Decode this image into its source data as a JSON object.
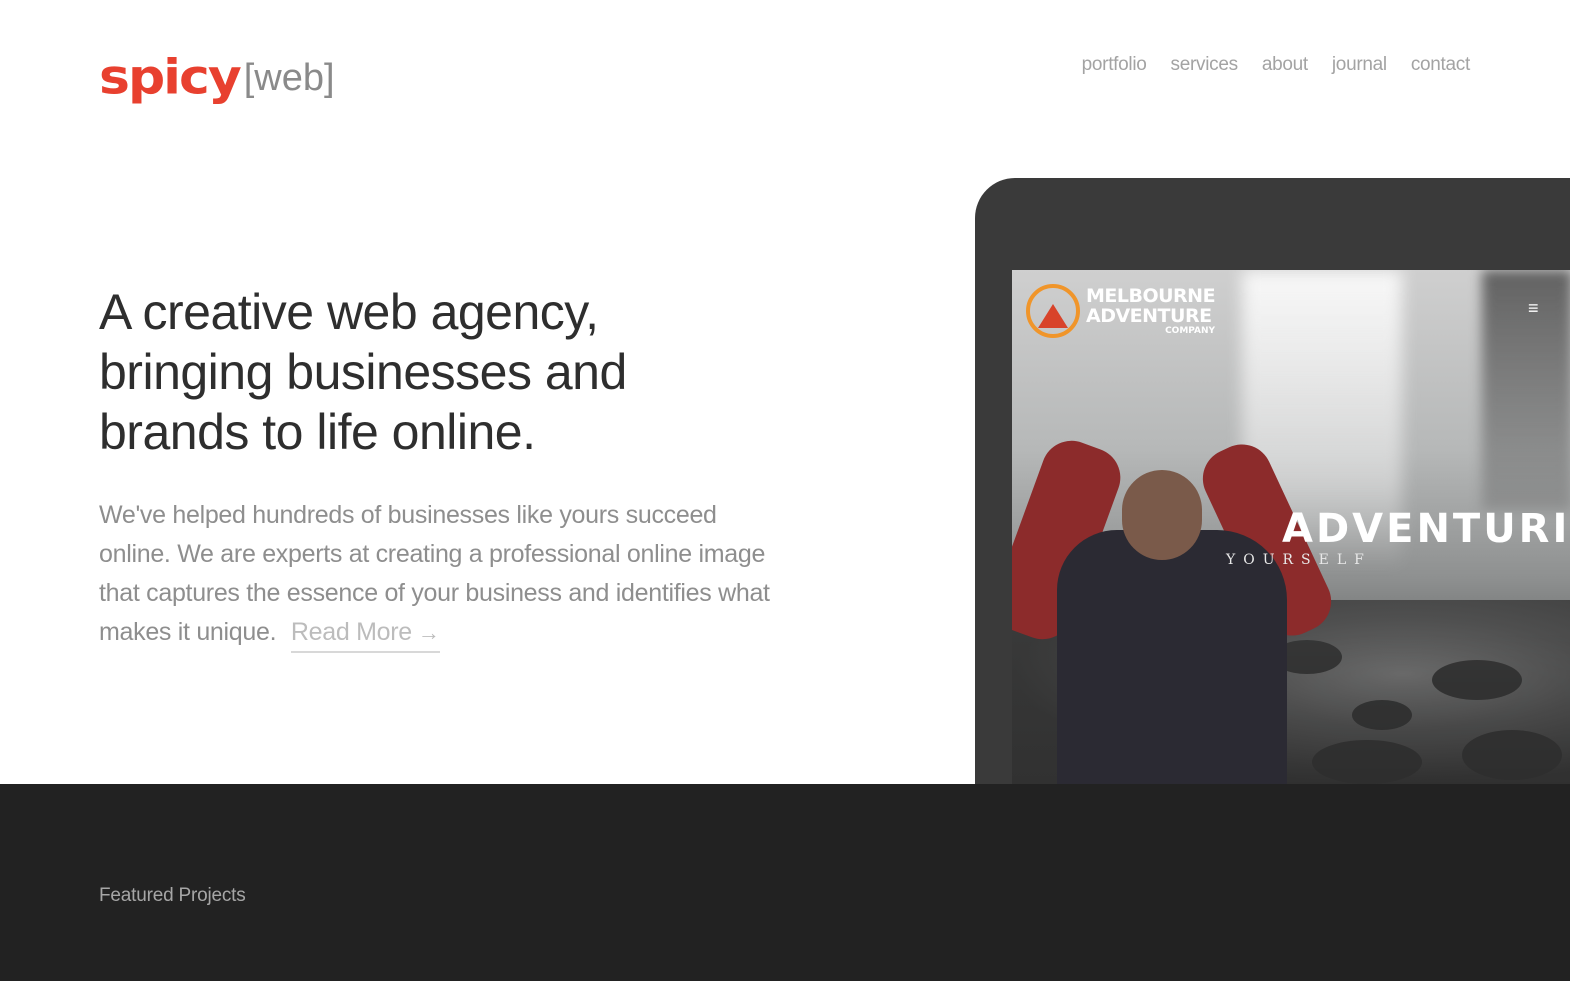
{
  "header": {
    "logo_main": "spicy",
    "logo_suffix": "[web]",
    "nav": [
      "portfolio",
      "services",
      "about",
      "journal",
      "contact"
    ]
  },
  "hero": {
    "title": "A creative web agency, bringing businesses and brands to life online.",
    "description": "We've helped hundreds of businesses like yours succeed online. We are experts at creating a professional online image that captures the essence of your business and identifies what makes it unique.",
    "read_more": "Read More",
    "read_more_arrow": "→"
  },
  "device_preview": {
    "brand_line1": "MELBOURNE",
    "brand_line2": "ADVENTURE",
    "brand_line3": "COMPANY",
    "menu_icon": "≡",
    "headline": "ADVENTURIZE",
    "subheadline": "YOURSELF"
  },
  "featured": {
    "label": "Featured Projects"
  },
  "colors": {
    "brand_red": "#e8402f",
    "nav_gray": "#a3a3a3",
    "dark_band": "#222222",
    "device_frame": "#3a3a3a",
    "accent_orange": "#f0952a"
  }
}
